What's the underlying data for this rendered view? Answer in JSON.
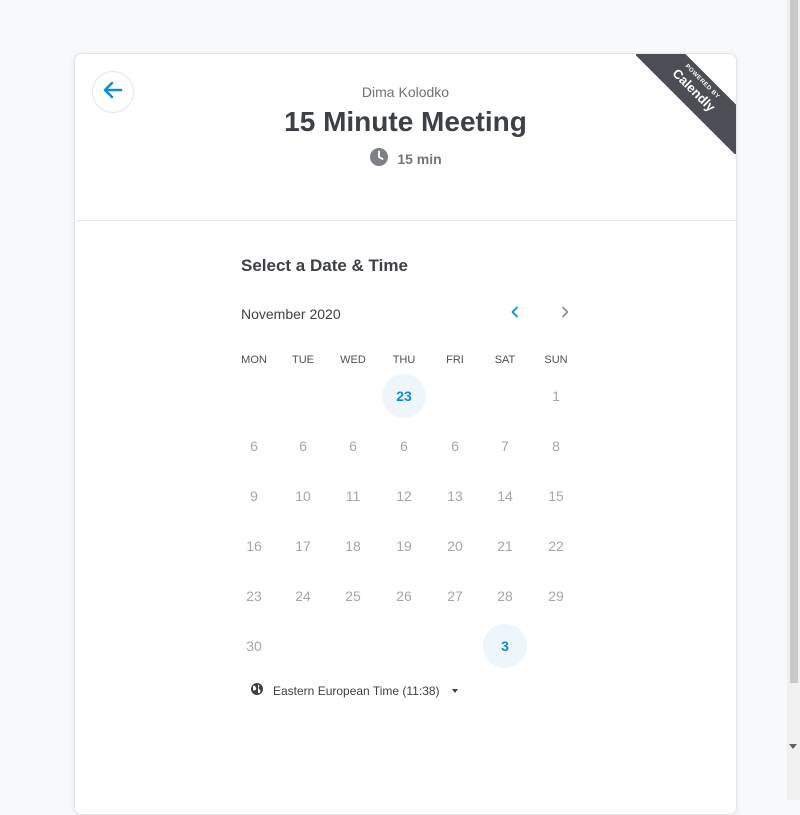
{
  "header": {
    "owner": "Dima Kolodko",
    "title": "15 Minute Meeting",
    "duration": "15 min",
    "ribbon_small": "POWERED BY",
    "ribbon_big": "Calendly"
  },
  "calendar": {
    "section_title": "Select a Date & Time",
    "month": "November 2020",
    "weekdays": [
      "MON",
      "TUE",
      "WED",
      "THU",
      "FRI",
      "SAT",
      "SUN"
    ],
    "rows": [
      [
        "",
        "",
        "",
        "23",
        "",
        "",
        "1"
      ],
      [
        "6",
        "6",
        "6",
        "6",
        "6",
        "7",
        "8"
      ],
      [
        "9",
        "10",
        "11",
        "12",
        "13",
        "14",
        "15"
      ],
      [
        "16",
        "17",
        "18",
        "19",
        "20",
        "21",
        "22"
      ],
      [
        "23",
        "24",
        "25",
        "26",
        "27",
        "28",
        "29"
      ],
      [
        "30",
        "",
        "",
        "",
        "",
        "3",
        ""
      ]
    ],
    "available": [
      "0-3",
      "5-5"
    ]
  },
  "timezone": {
    "label": "Eastern European Time (11:38)"
  },
  "colors": {
    "accent": "#0a8ed0",
    "available_bg": "#eef6fb",
    "ribbon": "#4b4f55"
  }
}
